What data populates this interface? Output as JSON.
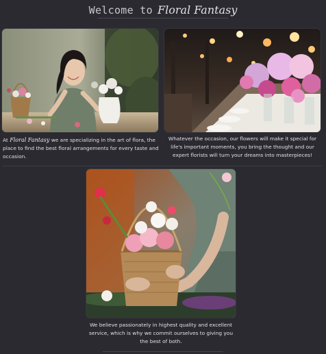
{
  "header": {
    "welcome_text": "Welcome to",
    "brand_name": "Floral Fantasy"
  },
  "cards": [
    {
      "image_icon": "florist-portrait-image",
      "caption_prefix": "At",
      "caption_brand": "Floral Fantasy",
      "caption_text": "we are specializing in the art of flora, the place to find the best floral arrangements for every taste and occasion."
    },
    {
      "image_icon": "event-table-flowers-image",
      "caption_text": "Whatever the occasion, our flowers will make it special for life's important moments, you bring the thought and our expert florists will turn your dreams into masterpieces!"
    },
    {
      "image_icon": "flower-basket-image",
      "caption_text": "We believe passionately in highest quality and excellent service, which is why we commit ourselves to giving you the best of both."
    }
  ],
  "colors": {
    "background": "#2b2a30",
    "text": "#e3e1e6",
    "divider": "#3f3d45"
  }
}
